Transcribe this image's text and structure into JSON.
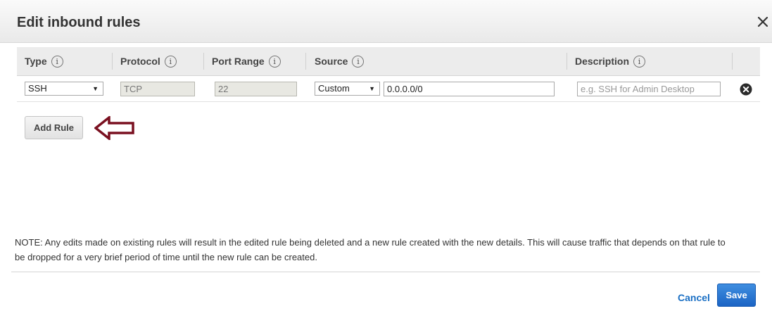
{
  "dialog": {
    "title": "Edit inbound rules"
  },
  "table": {
    "columns": [
      {
        "label": "Type"
      },
      {
        "label": "Protocol"
      },
      {
        "label": "Port Range"
      },
      {
        "label": "Source"
      },
      {
        "label": "Description"
      }
    ],
    "info_glyph": "i",
    "rows": [
      {
        "type": "SSH",
        "protocol": "TCP",
        "port_range": "22",
        "source_type": "Custom",
        "source_value": "0.0.0.0/0",
        "description_placeholder": "e.g. SSH for Admin Desktop",
        "description_value": ""
      }
    ]
  },
  "actions": {
    "add_rule_label": "Add Rule",
    "cancel_label": "Cancel",
    "save_label": "Save"
  },
  "note": "NOTE: Any edits made on existing rules will result in the edited rule being deleted and a new rule created with the new details. This will cause traffic that depends on that rule to be dropped for a very brief period of time until the new rule can be created.",
  "icons": {
    "close": "close-icon",
    "info": "info-icon",
    "remove": "remove-rule-icon",
    "dropdown": "chevron-down-icon",
    "annotation": "hollow-left-arrow"
  },
  "colors": {
    "primary_button": "#1b64c4",
    "link": "#1a6fc4",
    "annotation_arrow": "#7a1020",
    "header_bg": "#ececec"
  }
}
